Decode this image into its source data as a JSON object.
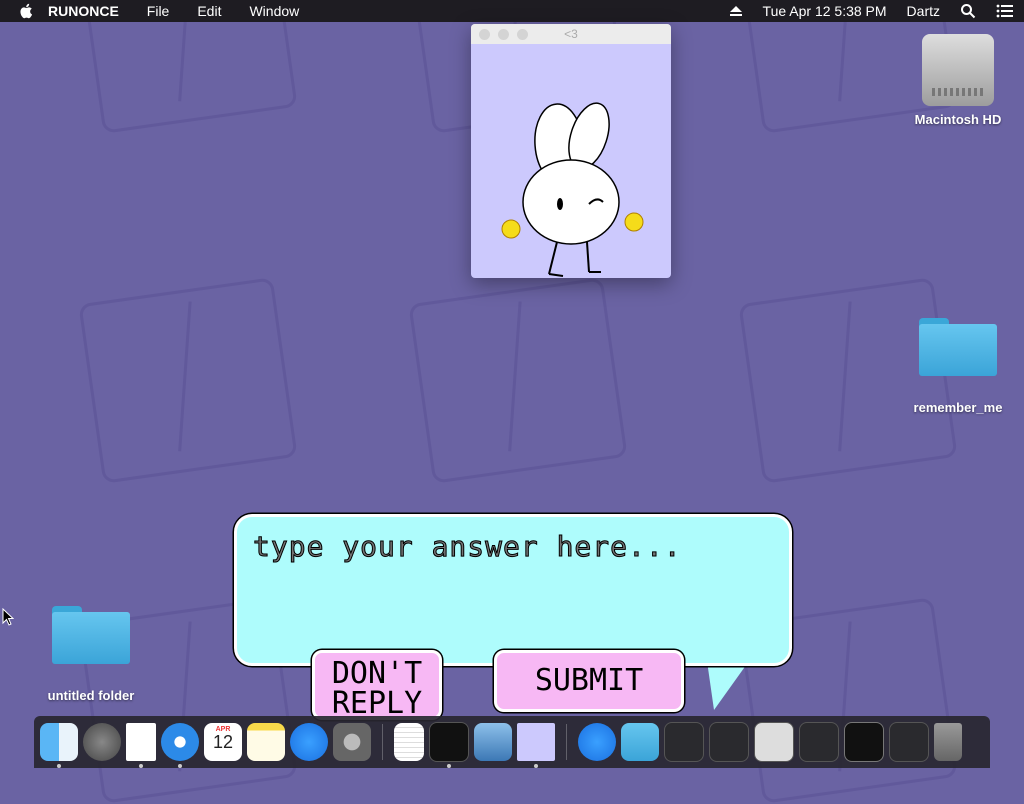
{
  "menubar": {
    "app_name": "RUNONCE",
    "menus": [
      "File",
      "Edit",
      "Window"
    ],
    "datetime": "Tue Apr 12  5:38 PM",
    "user": "Dartz"
  },
  "desktop": {
    "icons": [
      {
        "label": "Macintosh HD",
        "kind": "hard-drive"
      },
      {
        "label": "remember_me",
        "kind": "folder"
      },
      {
        "label": "untitled folder",
        "kind": "folder"
      }
    ]
  },
  "window": {
    "title": "<3",
    "bg_color": "#ccc9fd"
  },
  "dialog": {
    "answer_placeholder": "type your answer here...",
    "dont_reply_label": "DON'T REPLY",
    "submit_label": "SUBMIT",
    "bubble_color": "#aefcfc",
    "button_color": "#f7b8f4"
  },
  "dock": {
    "calendar_month": "APR",
    "calendar_day": "12",
    "items": [
      "finder-icon",
      "launchpad-icon",
      "document-icon",
      "safari-icon",
      "calendar-icon",
      "notes-icon",
      "app-store-icon",
      "system-preferences-icon",
      "textedit-icon",
      "terminal-icon",
      "preview-icon",
      "runonce-icon",
      "app-store-download-icon",
      "downloads-folder-icon",
      "window-thumb-icon",
      "window-thumb-icon",
      "window-thumb-icon",
      "window-thumb-icon",
      "window-thumb-icon",
      "window-thumb-icon",
      "trash-icon"
    ]
  }
}
